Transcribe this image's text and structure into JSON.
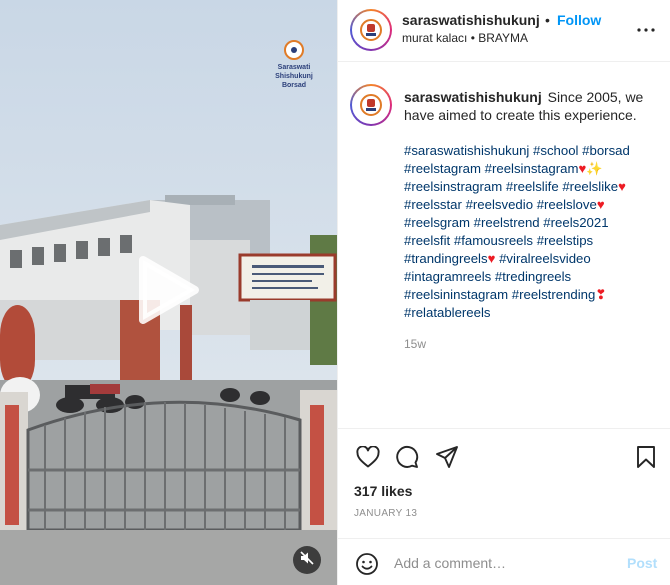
{
  "media": {
    "watermark": {
      "line1": "Saraswati Shishukunj",
      "line2": "Borsad"
    }
  },
  "header": {
    "username": "saraswatishishukunj",
    "separator": "•",
    "follow_label": "Follow",
    "subtitle": "murat kalacı • BRAYMA"
  },
  "caption": {
    "username": "saraswatishishukunj",
    "text": "Since 2005, we have aimed to create this experience.",
    "tags": [
      [
        {
          "t": "#saraswatishishukunj"
        },
        {
          "t": " "
        },
        {
          "t": "#school"
        },
        {
          "t": " "
        },
        {
          "t": "#borsad"
        }
      ],
      [
        {
          "t": "#reelstagram"
        },
        {
          "t": " "
        },
        {
          "t": "#reelsinstagram"
        },
        {
          "e": "♥",
          "c": "heart-emo"
        },
        {
          "e": "✨",
          "c": "sparkle"
        }
      ],
      [
        {
          "t": "#reelsinstragram"
        },
        {
          "t": " "
        },
        {
          "t": "#reelslife"
        },
        {
          "t": " "
        },
        {
          "t": "#reelslike"
        },
        {
          "e": "♥",
          "c": "heart-emo"
        }
      ],
      [
        {
          "t": "#reelsstar"
        },
        {
          "t": " "
        },
        {
          "t": "#reelsvedio"
        },
        {
          "t": " "
        },
        {
          "t": "#reelslove"
        },
        {
          "e": "♥",
          "c": "heart-emo"
        }
      ],
      [
        {
          "t": "#reelsgram"
        },
        {
          "t": " "
        },
        {
          "t": "#reelstrend"
        },
        {
          "t": " "
        },
        {
          "t": "#reels2021"
        }
      ],
      [
        {
          "t": "#reelsfit"
        },
        {
          "t": " "
        },
        {
          "t": "#famousreels"
        },
        {
          "t": " "
        },
        {
          "t": "#reelstips"
        }
      ],
      [
        {
          "t": "#trandingreels"
        },
        {
          "e": "♥",
          "c": "heart-emo"
        },
        {
          "t": " "
        },
        {
          "t": "#viralreelsvideo"
        }
      ],
      [
        {
          "t": "#intagramreels"
        },
        {
          "t": " "
        },
        {
          "t": "#tredingreels"
        }
      ],
      [
        {
          "t": "#reelsininstagram"
        },
        {
          "t": " "
        },
        {
          "t": "#reelstrending"
        },
        {
          "e": "❣",
          "c": "heart-emo"
        }
      ],
      [
        {
          "t": "#relatablereels"
        }
      ]
    ],
    "age": "15w"
  },
  "actions": {
    "likes": "317 likes",
    "date": "JANUARY 13"
  },
  "comment": {
    "placeholder": "Add a comment…",
    "post_label": "Post"
  },
  "colors": {
    "link": "#00376b",
    "follow": "#0095f6",
    "post_disabled": "#b2dffc"
  }
}
